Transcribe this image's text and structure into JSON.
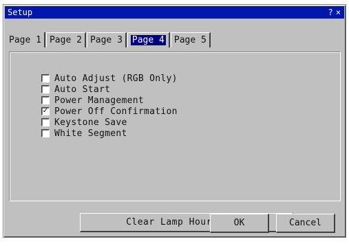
{
  "window": {
    "title": "Setup",
    "help_label": "?",
    "close_label": "×"
  },
  "tabs": [
    {
      "label": "Page 1",
      "active": false
    },
    {
      "label": "Page 2",
      "active": false
    },
    {
      "label": "Page 3",
      "active": false
    },
    {
      "label": "Page 4",
      "active": true
    },
    {
      "label": "Page 5",
      "active": false
    }
  ],
  "options": [
    {
      "label": "Auto Adjust (RGB Only)",
      "checked": false
    },
    {
      "label": "Auto Start",
      "checked": false
    },
    {
      "label": "Power Management",
      "checked": false
    },
    {
      "label": "Power Off Confirmation",
      "checked": true
    },
    {
      "label": "Keystone Save",
      "checked": false
    },
    {
      "label": "White Segment",
      "checked": false
    }
  ],
  "buttons": {
    "clear_lamp": "Clear Lamp Hour Meter",
    "ok": "OK",
    "cancel": "Cancel"
  },
  "colors": {
    "titlebar": "#0018a8",
    "window_bg": "#c0c0c0",
    "active_tab_bg": "#000080"
  }
}
